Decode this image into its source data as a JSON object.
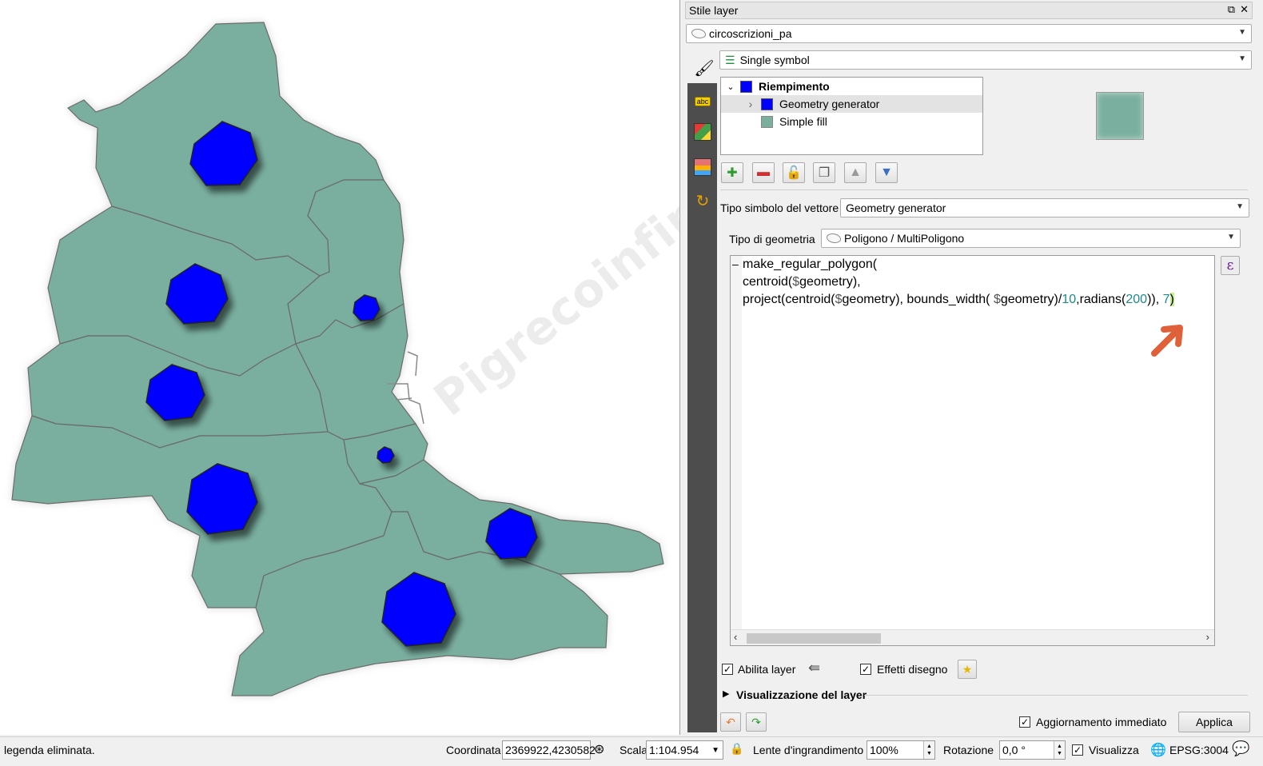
{
  "map": {
    "watermark": "Pigrecoinfinito",
    "fill_color": "#7aaf9f",
    "border_color": "#6b6b6b",
    "marker_color": "#0000ff"
  },
  "panel": {
    "title": "Stile layer",
    "title_icons": [
      "float-icon",
      "close-icon"
    ],
    "layer_select": "circoscrizioni_pa",
    "renderer_select": "Single symbol",
    "symbol_tree": [
      {
        "label": "Riempimento",
        "color": "#0000ff",
        "bold": true
      },
      {
        "label": "Geometry generator",
        "color": "#0000ff",
        "bold": false
      },
      {
        "label": "Simple fill",
        "color": "#7aaf9f",
        "bold": false
      }
    ],
    "vector_type_label": "Tipo simbolo del vettore",
    "vector_type_value": "Geometry generator",
    "geom_type_label": "Tipo di geometria",
    "geom_type_value": "Poligono / MultiPoligono",
    "expression_lines": {
      "l1": "make_regular_polygon(",
      "l2a": "centroid(",
      "l2b": "$",
      "l2c": "geometry),",
      "l3a": "project(centroid(",
      "l3b": "$",
      "l3c": "geometry), bounds_width( ",
      "l3d": "$",
      "l3e": "geometry)/",
      "l3f": "10",
      "l3g": ",radians(",
      "l3h": "200",
      "l3i": ")), ",
      "l3j": "7",
      "l3k": ")"
    },
    "enable_layer_label": "Abilita layer",
    "draw_effects_label": "Effetti disegno",
    "layer_rendering_label": "Visualizzazione del layer",
    "live_update_label": "Aggiornamento immediato",
    "apply_label": "Applica"
  },
  "statusbar": {
    "message": "legenda eliminata.",
    "coord_label": "Coordinata",
    "coord_value": "2369922,4230582",
    "scale_label": "Scala",
    "scale_value": "1:104.954",
    "magnifier_label": "Lente d'ingrandimento",
    "magnifier_value": "100%",
    "rotation_label": "Rotazione",
    "rotation_value": "0,0 °",
    "render_label": "Visualizza",
    "crs_label": "EPSG:3004"
  }
}
